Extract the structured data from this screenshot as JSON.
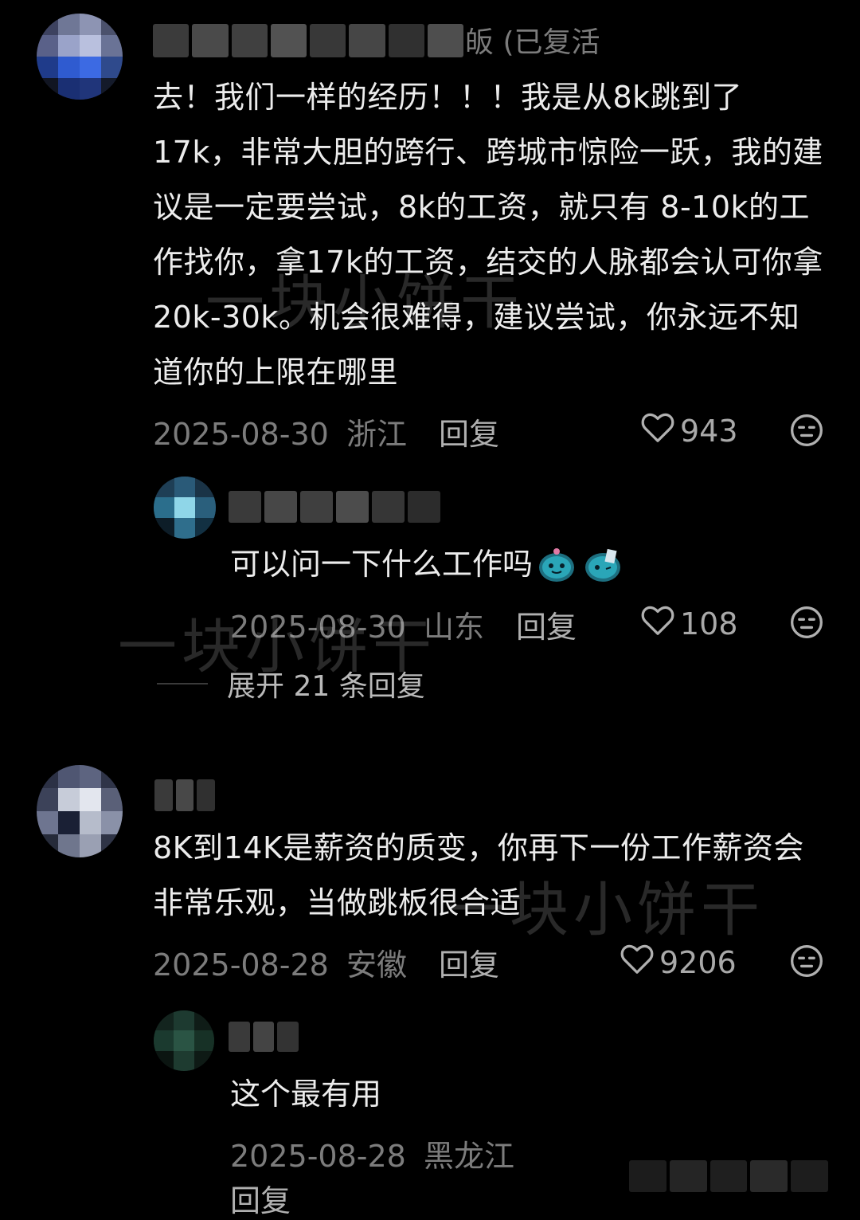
{
  "comments": [
    {
      "name_tail": "皈 (已复活",
      "text": "去！我们一样的经历！！！我是从8k跳到了17k，非常大胆的跨行、跨城市惊险一跃，我的建议是一定要尝试，8k的工资，就只有 8-10k的工作找你，拿17k的工资，结交的人脉都会认可你拿20k-30k。机会很难得，建议尝试，你永远不知道你的上限在哪里",
      "date": "2025-08-30",
      "region": "浙江",
      "reply_label": "回复",
      "likes": "943",
      "replies": [
        {
          "text": "可以问一下什么工作吗",
          "date": "2025-08-30",
          "region": "山东",
          "reply_label": "回复",
          "likes": "108"
        }
      ],
      "expand_label": "展开 21 条回复"
    },
    {
      "text": "8K到14K是薪资的质变，你再下一份工作薪资会非常乐观，当做跳板很合适",
      "date": "2025-08-28",
      "region": "安徽",
      "reply_label": "回复",
      "likes": "9206",
      "replies": [
        {
          "text": "这个最有用",
          "date": "2025-08-28",
          "region": "黑龙江",
          "reply_label": "回复"
        }
      ]
    }
  ],
  "watermark": "一块小饼干",
  "colors": {
    "background": "#000000",
    "text": "#ececec",
    "meta": "#7c7c7c"
  },
  "icons": [
    "heart-icon",
    "dislike-face-icon",
    "sticker-emoji"
  ]
}
